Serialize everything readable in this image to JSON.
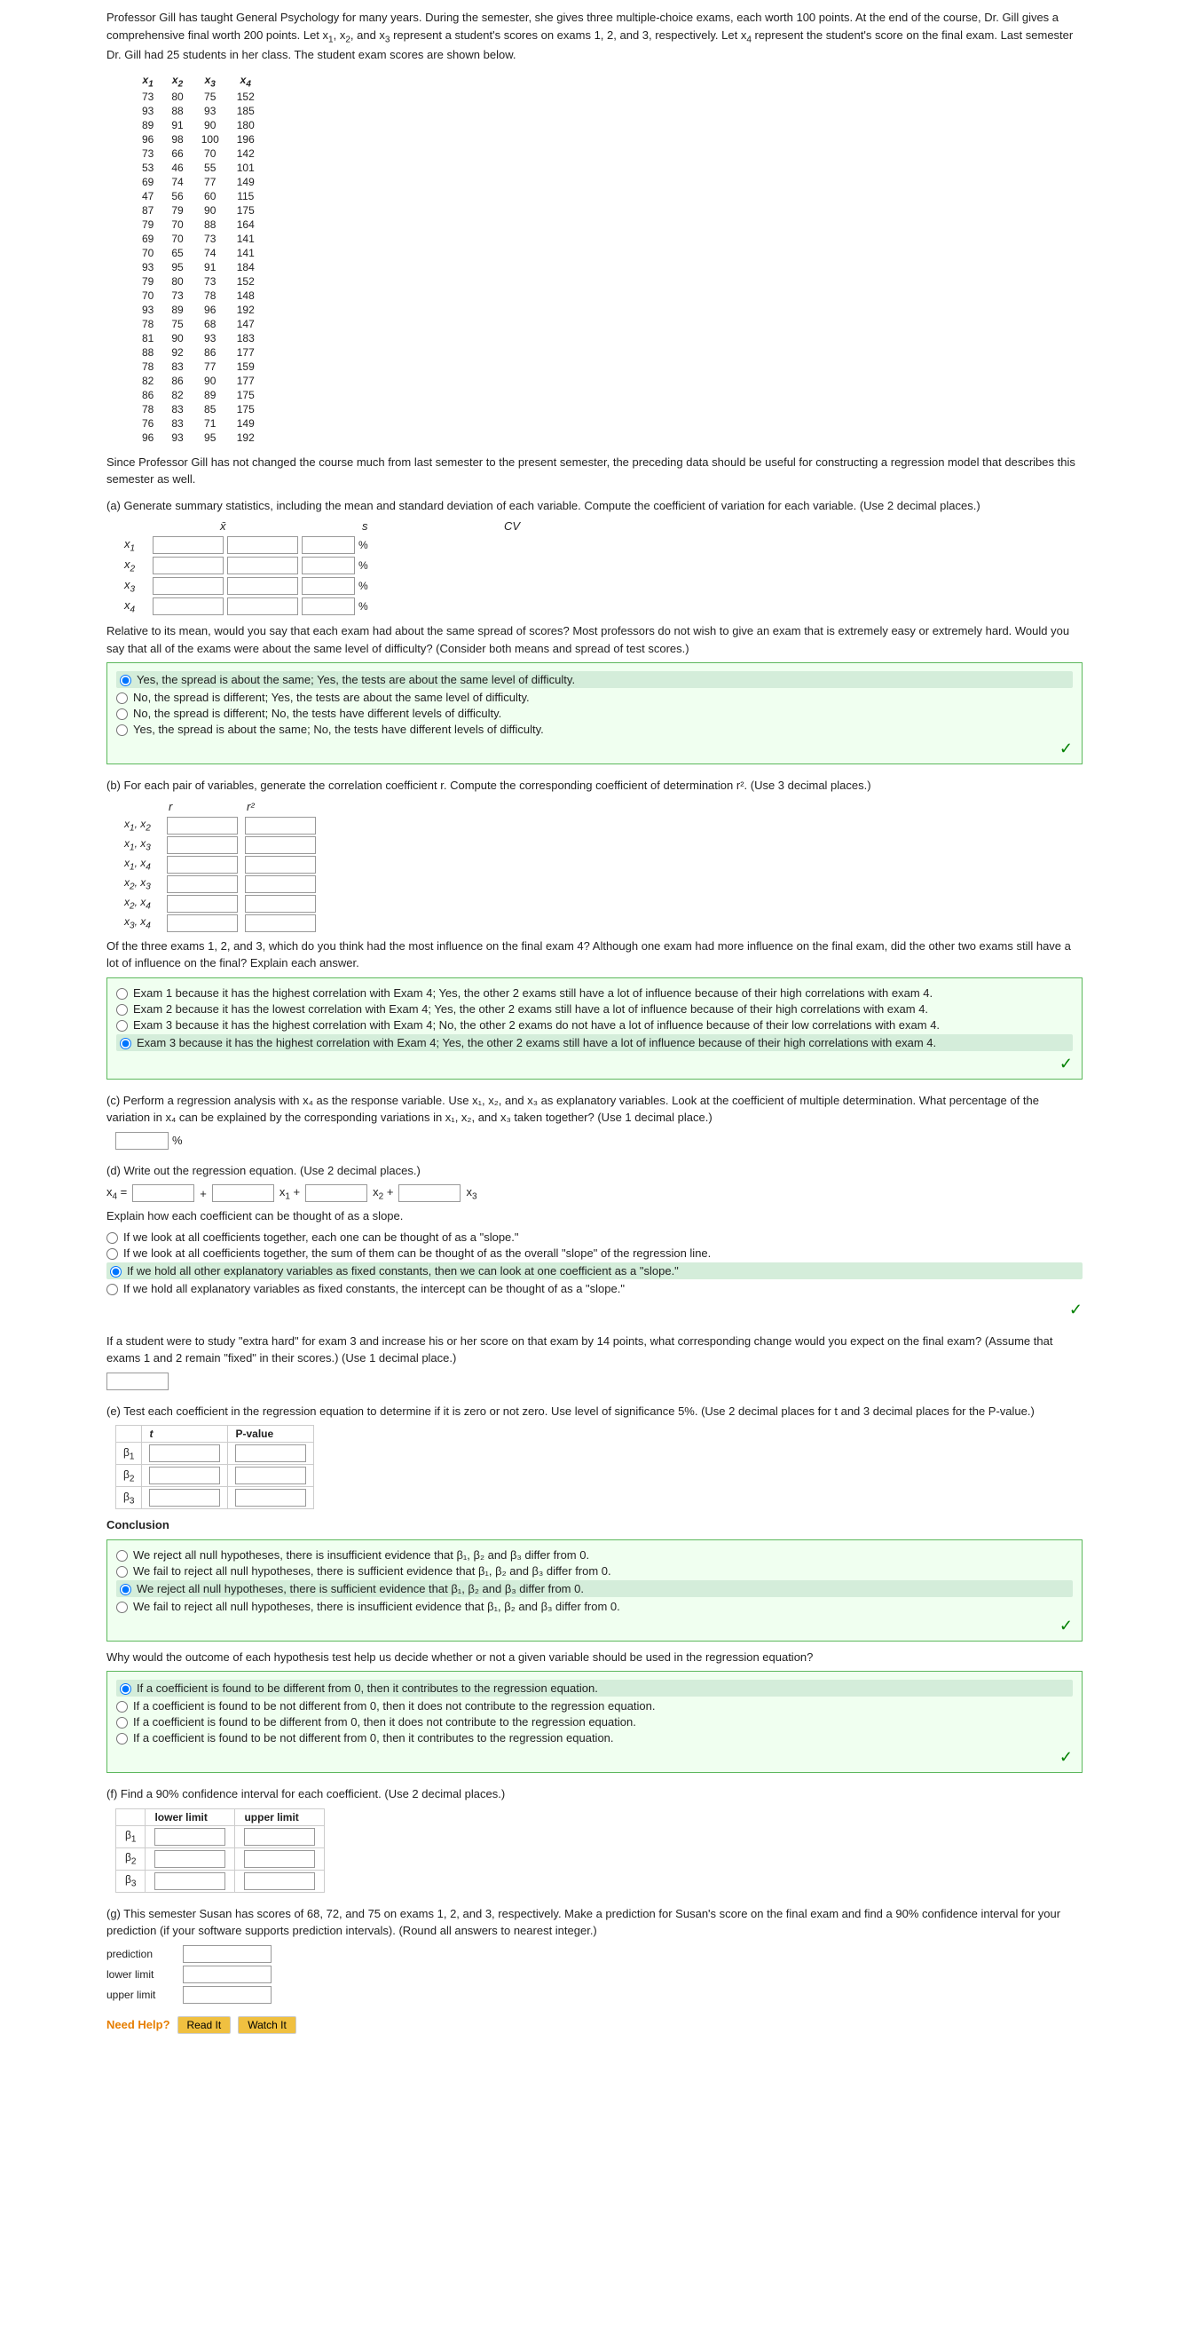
{
  "intro": {
    "text1": "Professor Gill has taught General Psychology for many years. During the semester, she gives three multiple-choice exams, each worth 100 points. At the end of the course, Dr. Gill gives a comprehensive final worth 200 points. Let x",
    "text2": ", x",
    "text3": ", and x",
    "text4": " represent a student's scores on exams 1, 2, and 3, respectively. Let x",
    "text5": " represent the student's score on the final exam. Last semester Dr. Gill had 25 students in her class. The student exam scores are shown below."
  },
  "table": {
    "headers": [
      "x₁",
      "x₂",
      "x₃",
      "x₄"
    ],
    "rows": [
      [
        73,
        80,
        75,
        152
      ],
      [
        93,
        88,
        93,
        185
      ],
      [
        89,
        91,
        90,
        180
      ],
      [
        96,
        98,
        100,
        196
      ],
      [
        73,
        66,
        70,
        142
      ],
      [
        53,
        46,
        55,
        101
      ],
      [
        69,
        74,
        77,
        149
      ],
      [
        47,
        56,
        60,
        115
      ],
      [
        87,
        79,
        90,
        175
      ],
      [
        79,
        70,
        88,
        164
      ],
      [
        69,
        70,
        73,
        141
      ],
      [
        70,
        65,
        74,
        141
      ],
      [
        93,
        95,
        91,
        184
      ],
      [
        79,
        80,
        73,
        152
      ],
      [
        70,
        73,
        78,
        148
      ],
      [
        93,
        89,
        96,
        192
      ],
      [
        78,
        75,
        68,
        147
      ],
      [
        81,
        90,
        93,
        183
      ],
      [
        88,
        92,
        86,
        177
      ],
      [
        78,
        83,
        77,
        159
      ],
      [
        82,
        86,
        90,
        177
      ],
      [
        86,
        82,
        89,
        175
      ],
      [
        78,
        83,
        85,
        175
      ],
      [
        76,
        83,
        71,
        149
      ],
      [
        96,
        93,
        95,
        192
      ]
    ]
  },
  "part_a": {
    "label": "(a) Generate summary statistics, including the mean and standard deviation of each variable. Compute the coefficient of variation for each variable. (Use 2 decimal places.)",
    "col_x": "x̄",
    "col_s": "s",
    "col_cv": "CV",
    "rows": [
      {
        "label": "x₁",
        "x": "",
        "s": "",
        "cv": "",
        "pct": "%"
      },
      {
        "label": "x₂",
        "x": "",
        "s": "",
        "cv": "",
        "pct": "%"
      },
      {
        "label": "x₃",
        "x": "",
        "s": "",
        "cv": "",
        "pct": "%"
      },
      {
        "label": "x₄",
        "x": "",
        "s": "",
        "cv": "",
        "pct": "%"
      }
    ],
    "question": "Relative to its mean, would you say that each exam had about the same spread of scores? Most professors do not wish to give an exam that is extremely easy or extremely hard. Would you say that all of the exams were about the same level of difficulty? (Consider both means and spread of test scores.)",
    "options": [
      {
        "id": "a1",
        "text": "Yes, the spread is about the same; Yes, the tests are about the same level of difficulty.",
        "selected": true
      },
      {
        "id": "a2",
        "text": "No, the spread is different; Yes, the tests are about the same level of difficulty.",
        "selected": false
      },
      {
        "id": "a3",
        "text": "No, the spread is different; No, the tests have different levels of difficulty.",
        "selected": false
      },
      {
        "id": "a4",
        "text": "Yes, the spread is about the same; No, the tests have different levels of difficulty.",
        "selected": false
      }
    ]
  },
  "part_b": {
    "label": "(b) For each pair of variables, generate the correlation coefficient r. Compute the corresponding coefficient of determination r². (Use 3 decimal places.)",
    "col_r": "r",
    "col_r2": "r²",
    "rows": [
      {
        "label": "x₁, x₂",
        "r": "",
        "r2": ""
      },
      {
        "label": "x₁, x₃",
        "r": "",
        "r2": ""
      },
      {
        "label": "x₁, x₄",
        "r": "",
        "r2": ""
      },
      {
        "label": "x₂, x₃",
        "r": "",
        "r2": ""
      },
      {
        "label": "x₂, x₄",
        "r": "",
        "r2": ""
      },
      {
        "label": "x₃, x₄",
        "r": "",
        "r2": ""
      }
    ],
    "question": "Of the three exams 1, 2, and 3, which do you think had the most influence on the final exam 4? Although one exam had more influence on the final exam, did the other two exams still have a lot of influence on the final? Explain each answer.",
    "options": [
      {
        "id": "b1",
        "text": "Exam 1 because it has the highest correlation with Exam 4; Yes, the other 2 exams still have a lot of influence because of their high correlations with exam 4.",
        "selected": false
      },
      {
        "id": "b2",
        "text": "Exam 2 because it has the lowest correlation with Exam 4; Yes, the other 2 exams still have a lot of influence because of their high correlations with exam 4.",
        "selected": false
      },
      {
        "id": "b3",
        "text": "Exam 3 because it has the highest correlation with Exam 4; No, the other 2 exams do not have a lot of influence because of their low correlations with exam 4.",
        "selected": false
      },
      {
        "id": "b4",
        "text": "Exam 3 because it has the highest correlation with Exam 4; Yes, the other 2 exams still have a lot of influence because of their high correlations with exam 4.",
        "selected": true
      }
    ]
  },
  "part_c": {
    "label": "(c) Perform a regression analysis with x₄ as the response variable. Use x₁, x₂, and x₃ as explanatory variables. Look at the coefficient of multiple determination. What percentage of the variation in x₄ can be explained by the corresponding variations in x₁, x₂, and x₃ taken together? (Use 1 decimal place.)",
    "pct_placeholder": "",
    "pct_suffix": "%"
  },
  "part_d": {
    "label": "(d) Write out the regression equation. (Use 2 decimal places.)",
    "eq_x4": "x₄ =",
    "eq_plus1": "+",
    "eq_x1": "x₁ +",
    "eq_plus2": "",
    "eq_x2": "x₂ +",
    "eq_x3": "x₃",
    "explain_label": "Explain how each coefficient can be thought of as a slope.",
    "options": [
      {
        "id": "d1",
        "text": "If we look at all coefficients together, each one can be thought of as a \"slope.\"",
        "selected": false
      },
      {
        "id": "d2",
        "text": "If we look at all coefficients together, the sum of them can be thought of as the overall \"slope\" of the regression line.",
        "selected": false
      },
      {
        "id": "d3",
        "text": "If we hold all other explanatory variables as fixed constants, then we can look at one coefficient as a \"slope.\"",
        "selected": true
      },
      {
        "id": "d4",
        "text": "If we hold all explanatory variables as fixed constants, the intercept can be thought of as a \"slope.\"",
        "selected": false
      }
    ],
    "followup": "If a student were to study \"extra hard\" for exam 3 and increase his or her score on that exam by 14 points, what corresponding change would you expect on the final exam? (Assume that exams 1 and 2 remain \"fixed\" in their scores.) (Use 1 decimal place.)",
    "change_placeholder": ""
  },
  "part_e": {
    "label": "(e) Test each coefficient in the regression equation to determine if it is zero or not zero. Use level of significance 5%. (Use 2 decimal places for t and 3 decimal places for the P-value.)",
    "col_t": "t",
    "col_p": "P-value",
    "rows": [
      {
        "label": "β₁",
        "t": "",
        "p": ""
      },
      {
        "label": "β₂",
        "t": "",
        "p": ""
      },
      {
        "label": "β₃",
        "t": "",
        "p": ""
      }
    ],
    "conclusion_label": "Conclusion",
    "options": [
      {
        "id": "e1",
        "text": "We reject all null hypotheses, there is insufficient evidence that β₁, β₂ and β₃ differ from 0.",
        "selected": false
      },
      {
        "id": "e2",
        "text": "We fail to reject all null hypotheses, there is sufficient evidence that β₁, β₂ and β₃ differ from 0.",
        "selected": false
      },
      {
        "id": "e3",
        "text": "We reject all null hypotheses, there is sufficient evidence that β₁, β₂ and β₃ differ from 0.",
        "selected": true
      },
      {
        "id": "e4",
        "text": "We fail to reject all null hypotheses, there is insufficient evidence that β₁, β₂ and β₃ differ from 0.",
        "selected": false
      }
    ],
    "why_label": "Why would the outcome of each hypothesis test help us decide whether or not a given variable should be used in the regression equation?",
    "why_options": [
      {
        "id": "ew1",
        "text": "If a coefficient is found to be different from 0, then it contributes to the regression equation.",
        "selected": true
      },
      {
        "id": "ew2",
        "text": "If a coefficient is found to be not different from 0, then it does not contribute to the regression equation.",
        "selected": false
      },
      {
        "id": "ew3",
        "text": "If a coefficient is found to be different from 0, then it does not contribute to the regression equation.",
        "selected": false
      },
      {
        "id": "ew4",
        "text": "If a coefficient is found to be not different from 0, then it contributes to the regression equation.",
        "selected": false
      }
    ]
  },
  "part_f": {
    "label": "(f) Find a 90% confidence interval for each coefficient. (Use 2 decimal places.)",
    "col_lower": "lower limit",
    "col_upper": "upper limit",
    "rows": [
      {
        "label": "β₁",
        "lower": "",
        "upper": ""
      },
      {
        "label": "β₂",
        "lower": "",
        "upper": ""
      },
      {
        "label": "β₃",
        "lower": "",
        "upper": ""
      }
    ]
  },
  "part_g": {
    "label": "(g) This semester Susan has scores of 68, 72, and 75 on exams 1, 2, and 3, respectively. Make a prediction for Susan's score on the final exam and find a 90% confidence interval for your prediction (if your software supports prediction intervals). (Round all answers to nearest integer.)",
    "prediction_label": "prediction",
    "lower_label": "lower limit",
    "upper_label": "upper limit",
    "prediction_value": "",
    "lower_value": "",
    "upper_value": ""
  },
  "help": {
    "label": "Need Help?",
    "read_btn": "Read It",
    "watch_btn": "Watch It"
  }
}
